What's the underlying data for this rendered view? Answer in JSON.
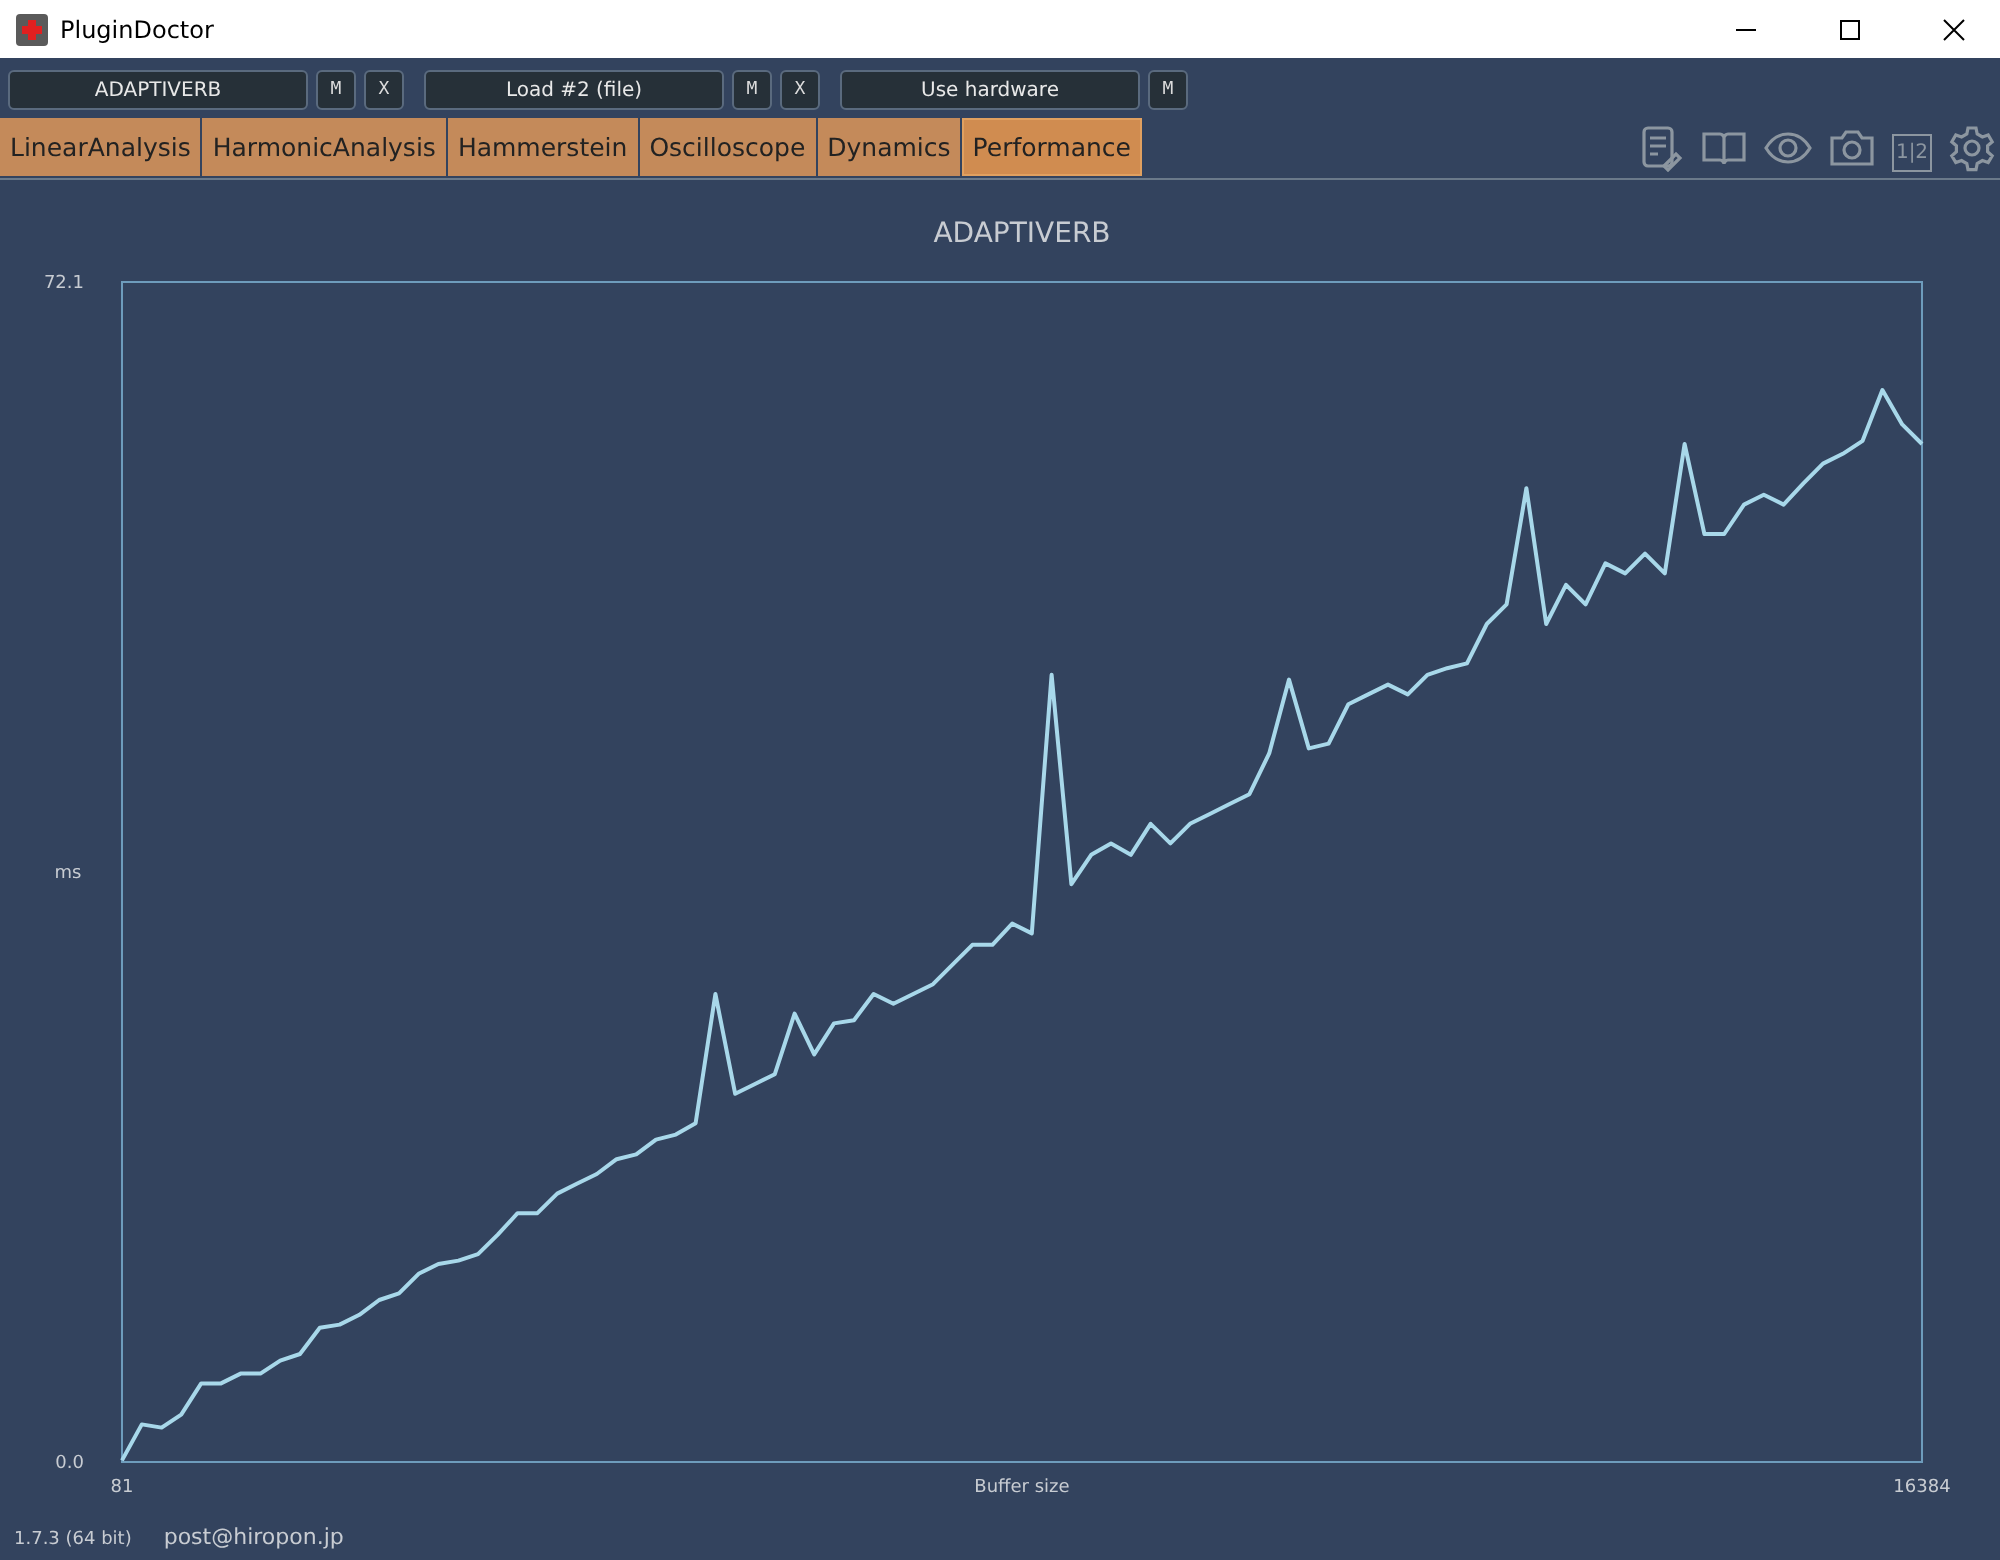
{
  "window": {
    "title": "PluginDoctor"
  },
  "slots": [
    {
      "label": "ADAPTIVERB",
      "buttons": [
        "M",
        "X"
      ]
    },
    {
      "label": "Load #2 (file)",
      "buttons": [
        "M",
        "X"
      ]
    },
    {
      "label": "Use hardware",
      "buttons": [
        "M"
      ]
    }
  ],
  "tabs": [
    {
      "label": "LinearAnalysis",
      "selected": false
    },
    {
      "label": "HarmonicAnalysis",
      "selected": false
    },
    {
      "label": "Hammerstein",
      "selected": false
    },
    {
      "label": "Oscilloscope",
      "selected": false
    },
    {
      "label": "Dynamics",
      "selected": false
    },
    {
      "label": "Performance",
      "selected": true
    }
  ],
  "toolbar_icons": [
    "1|2"
  ],
  "chart": {
    "chart_data": {
      "type": "line",
      "title": "ADAPTIVERB",
      "xlabel": "Buffer size",
      "ylabel": "ms",
      "xlim": [
        81,
        16384
      ],
      "xticks": [
        81,
        16384
      ],
      "ylim": [
        0,
        72.1
      ],
      "yticks": [
        {
          "value": 0,
          "label": "0.0"
        },
        72.1
      ],
      "x": [
        81,
        260,
        439,
        618,
        798,
        977,
        1156,
        1335,
        1514,
        1693,
        1873,
        2052,
        2231,
        2410,
        2589,
        2768,
        2947,
        3127,
        3306,
        3485,
        3664,
        3843,
        4022,
        4201,
        4381,
        4560,
        4739,
        4918,
        5097,
        5276,
        5456,
        5635,
        5814,
        5993,
        6172,
        6351,
        6530,
        6710,
        6889,
        7068,
        7247,
        7426,
        7605,
        7784,
        7964,
        8143,
        8322,
        8501,
        8680,
        8859,
        9039,
        9218,
        9397,
        9576,
        9755,
        9934,
        10113,
        10293,
        10472,
        10651,
        10830,
        11009,
        11188,
        11368,
        11547,
        11726,
        11905,
        12084,
        12263,
        12442,
        12622,
        12801,
        12980,
        13159,
        13338,
        13517,
        13696,
        13876,
        14055,
        14234,
        14413,
        14592,
        14771,
        14951,
        15130,
        15309,
        15488,
        15667,
        15846,
        16025,
        16205,
        16384
      ],
      "series": [
        {
          "color": "#a8d8ea",
          "values": [
            0.1,
            2.3,
            2.1,
            2.9,
            4.8,
            4.8,
            5.4,
            5.4,
            6.2,
            6.6,
            8.2,
            8.4,
            9.0,
            9.9,
            10.3,
            11.5,
            12.1,
            12.3,
            12.7,
            13.9,
            15.2,
            15.2,
            16.4,
            17.0,
            17.6,
            18.5,
            18.8,
            19.7,
            20.0,
            20.7,
            28.6,
            22.5,
            23.1,
            23.7,
            27.4,
            24.9,
            26.8,
            27.0,
            28.6,
            28.0,
            28.6,
            29.2,
            30.4,
            31.6,
            31.6,
            32.9,
            32.3,
            48.1,
            35.3,
            37.1,
            37.8,
            37.1,
            39.0,
            37.8,
            39.0,
            39.6,
            40.2,
            40.8,
            43.3,
            47.8,
            43.6,
            43.9,
            46.3,
            46.9,
            47.5,
            46.9,
            48.1,
            48.5,
            48.8,
            51.2,
            52.4,
            59.5,
            51.2,
            53.6,
            52.4,
            54.9,
            54.3,
            55.5,
            54.3,
            62.2,
            56.7,
            56.7,
            58.5,
            59.1,
            58.5,
            59.8,
            61.0,
            61.6,
            62.4,
            65.5,
            63.4,
            62.2
          ]
        }
      ]
    }
  },
  "status_bar": {
    "version": "1.7.3 (64 bit)",
    "email": "post@hiropon.jp"
  }
}
